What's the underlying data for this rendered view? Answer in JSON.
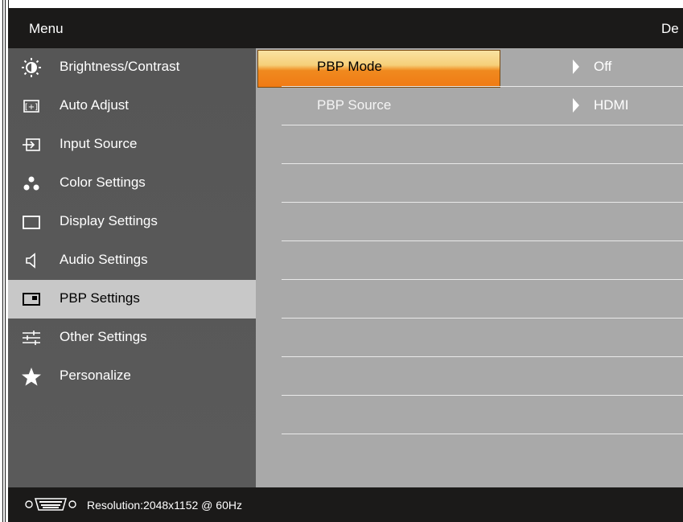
{
  "header": {
    "title": "Menu",
    "right_text": "De"
  },
  "sidebar": {
    "items": [
      {
        "label": "Brightness/Contrast",
        "icon": "brightness-icon"
      },
      {
        "label": "Auto Adjust",
        "icon": "auto-adjust-icon"
      },
      {
        "label": "Input Source",
        "icon": "input-source-icon"
      },
      {
        "label": "Color Settings",
        "icon": "color-settings-icon"
      },
      {
        "label": "Display Settings",
        "icon": "display-settings-icon"
      },
      {
        "label": "Audio Settings",
        "icon": "speaker-icon"
      },
      {
        "label": "PBP Settings",
        "icon": "pbp-icon",
        "active": true
      },
      {
        "label": "Other Settings",
        "icon": "sliders-icon"
      },
      {
        "label": "Personalize",
        "icon": "star-icon"
      }
    ]
  },
  "submenu": {
    "rows": [
      {
        "label": "PBP Mode",
        "value": "Off",
        "selected": true
      },
      {
        "label": "PBP Source",
        "value": "HDMI"
      }
    ]
  },
  "footer": {
    "connector_icon": "vga-connector-icon",
    "resolution": "Resolution:2048x1152 @ 60Hz"
  },
  "colors": {
    "header_bg": "#1b1a19",
    "sidebar_bg": "#585858",
    "content_bg": "#a9a9a9",
    "active_item_bg": "#c8c8c8",
    "highlight": "#f07a14"
  }
}
